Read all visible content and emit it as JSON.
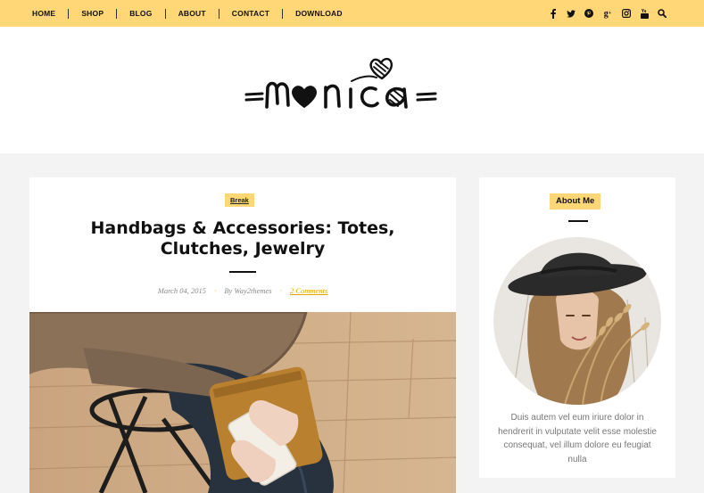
{
  "nav": {
    "items": [
      {
        "label": "HOME"
      },
      {
        "label": "SHOP"
      },
      {
        "label": "BLOG"
      },
      {
        "label": "ABOUT"
      },
      {
        "label": "CONTACT"
      },
      {
        "label": "DOWNLOAD"
      }
    ],
    "social_icons": [
      "facebook-icon",
      "twitter-icon",
      "pinterest-icon",
      "google-plus-icon",
      "instagram-icon",
      "youtube-icon",
      "search-icon"
    ]
  },
  "site": {
    "logo_text": "monica"
  },
  "post": {
    "category": "Break",
    "title": "Handbags & Accessories: Totes, Clutches, Jewelry",
    "date": "March 04, 2015",
    "author": "By Way2themes",
    "comments": "2 Comments"
  },
  "sidebar": {
    "about": {
      "title": "About Me",
      "text": "Duis autem vel eum iriure dolor in hendrerit in vulputate velit esse molestie consequat, vel illum dolore eu feugiat nulla"
    }
  },
  "colors": {
    "accent": "#ffd777",
    "link": "#e8a400",
    "background": "#f3f3f3"
  }
}
